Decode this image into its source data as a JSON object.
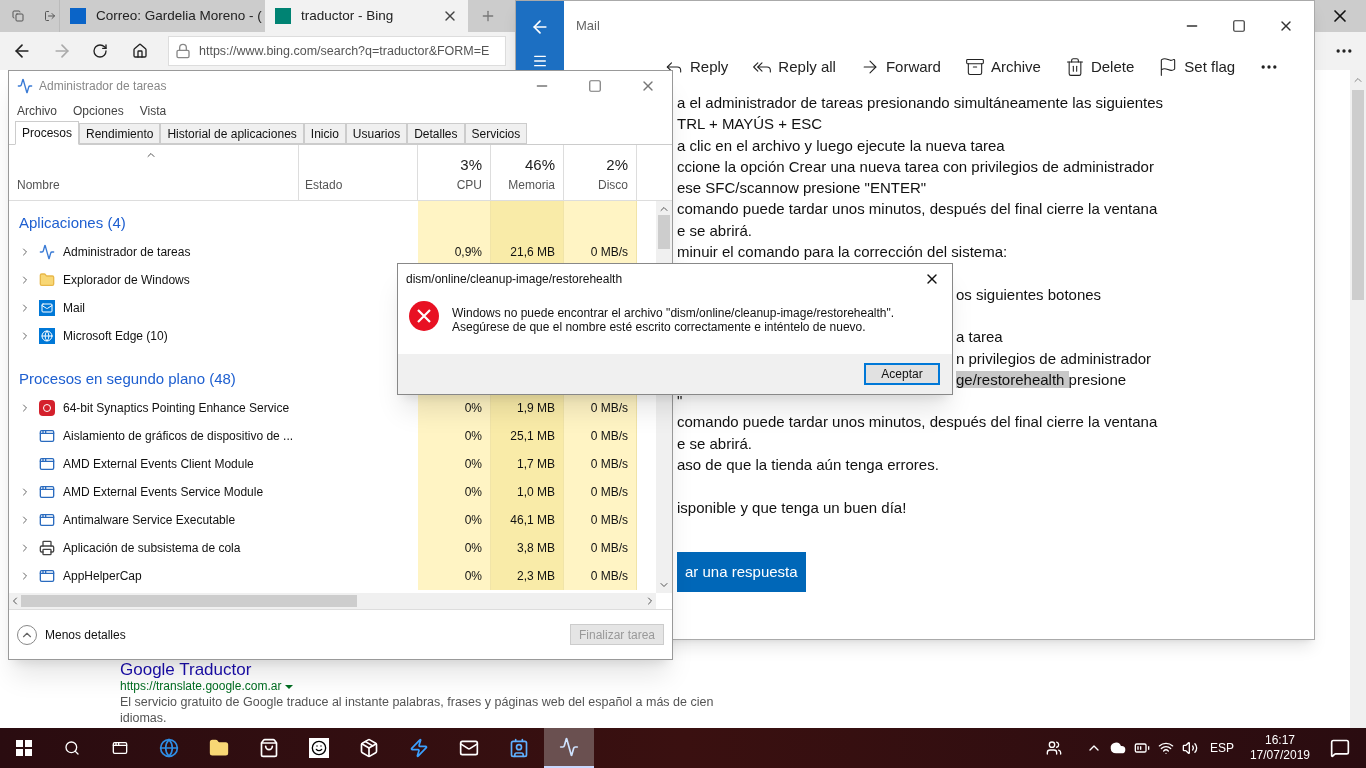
{
  "browser": {
    "tabs": [
      {
        "title": "Correo: Gardelia Moreno - (",
        "kind": "mail",
        "selected": false
      },
      {
        "title": "traductor - Bing",
        "kind": "bing",
        "selected": true
      }
    ],
    "address": "https://www.bing.com/search?q=traductor&FORM=E",
    "result": {
      "title": "Google Traductor",
      "url": "https://translate.google.com.ar",
      "description": "El servicio gratuito de Google traduce al instante palabras, frases y páginas web del español a más de cien idiomas."
    }
  },
  "mail": {
    "title": "Mail",
    "toolbar": [
      {
        "label": "Reply",
        "kind": "reply"
      },
      {
        "label": "Reply all",
        "kind": "replyall"
      },
      {
        "label": "Forward",
        "kind": "forward"
      },
      {
        "label": "Archive",
        "kind": "archive"
      },
      {
        "label": "Delete",
        "kind": "delete"
      },
      {
        "label": "Set flag",
        "kind": "flag"
      }
    ],
    "lines": [
      {
        "kind": "full",
        "text": "a el administrador de tareas presionando simultáneamente las siguientes"
      },
      {
        "kind": "full",
        "text": "TRL + MAYÚS + ESC"
      },
      {
        "kind": "full",
        "text": "a clic en el archivo y luego ejecute la nueva tarea"
      },
      {
        "kind": "full",
        "text": "ccione la opción Crear una nueva tarea con privilegios de administrador"
      },
      {
        "kind": "full",
        "text": "ese SFC/scannow presione \"ENTER\""
      },
      {
        "kind": "full",
        "text": "comando puede tardar unos minutos, después del final cierre la ventana"
      },
      {
        "kind": "full",
        "text": "e se abrirá."
      },
      {
        "kind": "full",
        "text": "minuir el comando para la corrección del sistema:"
      },
      {
        "kind": "gap"
      },
      {
        "kind": "right",
        "text": "os siguientes botones"
      },
      {
        "kind": "gap"
      },
      {
        "kind": "right",
        "text": "a tarea"
      },
      {
        "kind": "right",
        "text": "n privilegios de administrador"
      },
      {
        "kind": "right",
        "highlight": "ge/restorehealth",
        "text": "presione"
      },
      {
        "kind": "full",
        "text": "\""
      },
      {
        "kind": "full",
        "text": "comando puede tardar unos minutos, después del final cierre la ventana"
      },
      {
        "kind": "full",
        "text": "e se abrirá."
      },
      {
        "kind": "full",
        "text": "aso de que la tienda aún tenga errores."
      },
      {
        "kind": "gap"
      },
      {
        "kind": "full",
        "text": "isponible y que tenga un buen día!"
      }
    ],
    "reply_button": "ar una respuesta"
  },
  "task_manager": {
    "title": "Administrador de tareas",
    "menu": [
      "Archivo",
      "Opciones",
      "Vista"
    ],
    "tabs": [
      {
        "label": "Procesos",
        "selected": true
      },
      {
        "label": "Rendimiento",
        "selected": false
      },
      {
        "label": "Historial de aplicaciones",
        "selected": false
      },
      {
        "label": "Inicio",
        "selected": false
      },
      {
        "label": "Usuarios",
        "selected": false
      },
      {
        "label": "Detalles",
        "selected": false
      },
      {
        "label": "Servicios",
        "selected": false
      }
    ],
    "columns": {
      "name": "Nombre",
      "status": "Estado",
      "cpu": {
        "percent": "3%",
        "label": "CPU"
      },
      "memory": {
        "percent": "46%",
        "label": "Memoria"
      },
      "disk": {
        "percent": "2%",
        "label": "Disco"
      }
    },
    "groups": [
      {
        "title": "Aplicaciones (4)",
        "rows": [
          {
            "name": "Administrador de tareas",
            "kind": "taskmgr",
            "expandable": true,
            "cpu": "0,9%",
            "memory": "21,6 MB",
            "disk": "0 MB/s"
          },
          {
            "name": "Explorador de Windows",
            "kind": "folder",
            "expandable": true
          },
          {
            "name": "Mail",
            "kind": "mail",
            "expandable": true
          },
          {
            "name": "Microsoft Edge (10)",
            "kind": "edge",
            "expandable": true
          }
        ]
      },
      {
        "title": "Procesos en segundo plano (48)",
        "rows": [
          {
            "name": "64-bit Synaptics Pointing Enhance Service",
            "kind": "synaptics",
            "expandable": true,
            "cpu": "0%",
            "memory": "1,9 MB",
            "disk": "0 MB/s"
          },
          {
            "name": "Aislamiento de gráficos de dispositivo de ...",
            "kind": "window",
            "expandable": false,
            "cpu": "0%",
            "memory": "25,1 MB",
            "disk": "0 MB/s"
          },
          {
            "name": "AMD External Events Client Module",
            "kind": "window",
            "expandable": false,
            "cpu": "0%",
            "memory": "1,7 MB",
            "disk": "0 MB/s"
          },
          {
            "name": "AMD External Events Service Module",
            "kind": "window",
            "expandable": true,
            "cpu": "0%",
            "memory": "1,0 MB",
            "disk": "0 MB/s"
          },
          {
            "name": "Antimalware Service Executable",
            "kind": "window",
            "expandable": true,
            "cpu": "0%",
            "memory": "46,1 MB",
            "disk": "0 MB/s"
          },
          {
            "name": "Aplicación de subsistema de cola",
            "kind": "printer",
            "expandable": true,
            "cpu": "0%",
            "memory": "3,8 MB",
            "disk": "0 MB/s"
          },
          {
            "name": "AppHelperCap",
            "kind": "window",
            "expandable": true,
            "cpu": "0%",
            "memory": "2,3 MB",
            "disk": "0 MB/s"
          }
        ]
      }
    ],
    "less_details": "Menos detalles",
    "end_task": {
      "label": "Finalizar tarea",
      "disabled": true
    }
  },
  "dialog": {
    "title": "dism/online/cleanup-image/restorehealth",
    "message": [
      "Windows no puede encontrar el archivo \"dism/online/cleanup-image/restorehealth\".",
      "Asegúrese de que el nombre esté escrito correctamente e inténtelo de nuevo."
    ],
    "button": "Aceptar"
  },
  "taskbar": {
    "apps": [
      {
        "kind": "edge",
        "selected": false
      },
      {
        "kind": "folder",
        "selected": false
      },
      {
        "kind": "store",
        "selected": false
      },
      {
        "kind": "amazon",
        "selected": false
      },
      {
        "kind": "dropbox",
        "selected": false
      },
      {
        "kind": "bolt",
        "selected": false
      },
      {
        "kind": "mail",
        "selected": false
      },
      {
        "kind": "contacts",
        "selected": false
      },
      {
        "kind": "taskmgr",
        "selected": true
      }
    ],
    "language": "ESP",
    "time": "16:17",
    "date": "17/07/2019"
  }
}
